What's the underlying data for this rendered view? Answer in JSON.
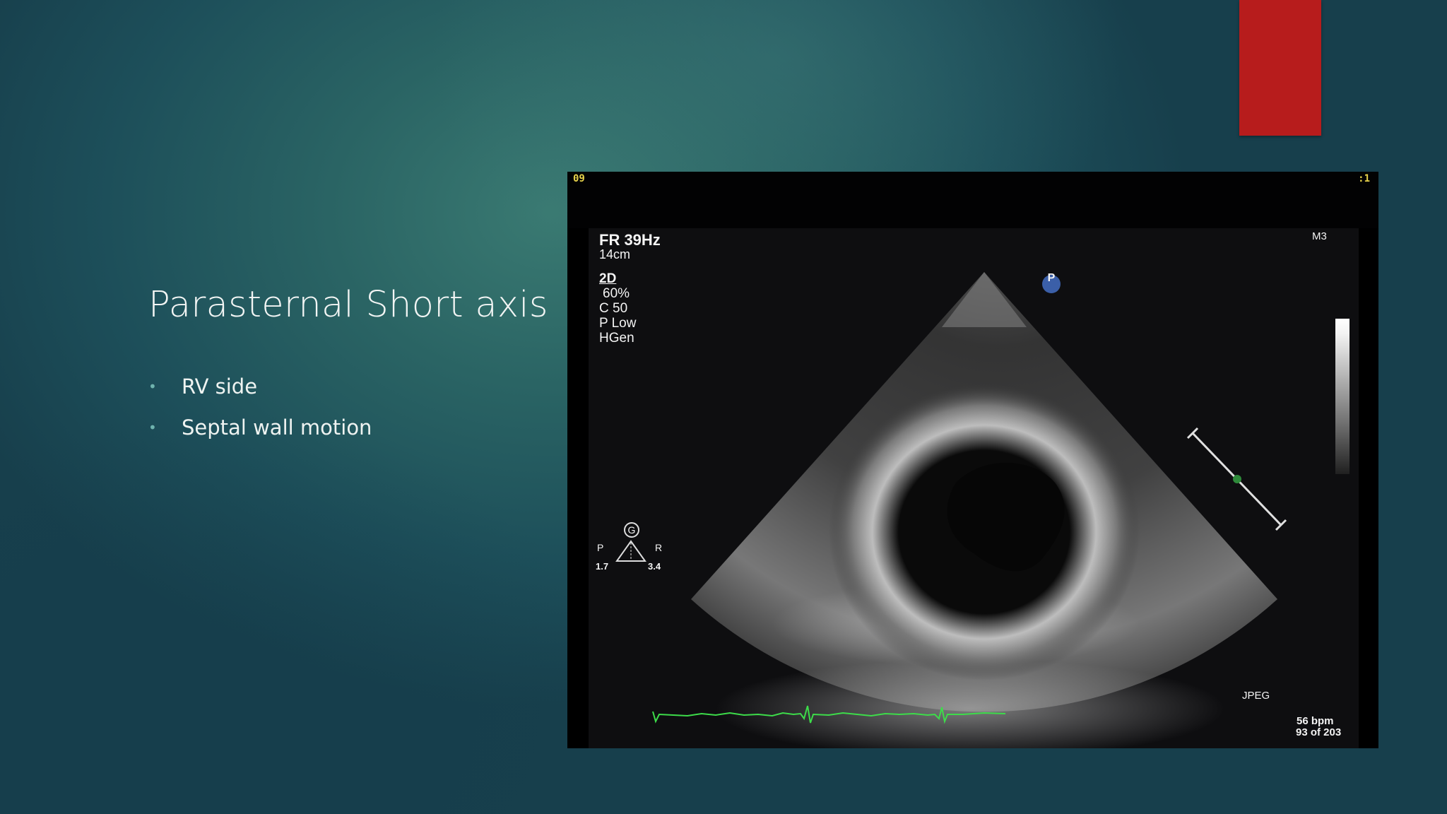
{
  "slide": {
    "title": "Parasternal Short axis",
    "bullets": [
      "RV side",
      "Septal wall motion"
    ],
    "accent_color": "#b71c1c"
  },
  "echo": {
    "stamp_left": "09",
    "stamp_right": ":1",
    "frame_rate": "FR 39Hz",
    "depth": "14cm",
    "mode": "2D",
    "gain": "60%",
    "compression": "C 50",
    "power": "P Low",
    "harmonic": "HGen",
    "probe_label": "M3",
    "orientation_marker": "P",
    "g_marker": "G",
    "left_letter": "P",
    "right_letter": "R",
    "scale_left": "1.7",
    "scale_right": "3.4",
    "format": "JPEG",
    "heart_rate": "56 bpm",
    "frame_counter": "93 of 203",
    "ecg_color": "#3ddc4a"
  }
}
